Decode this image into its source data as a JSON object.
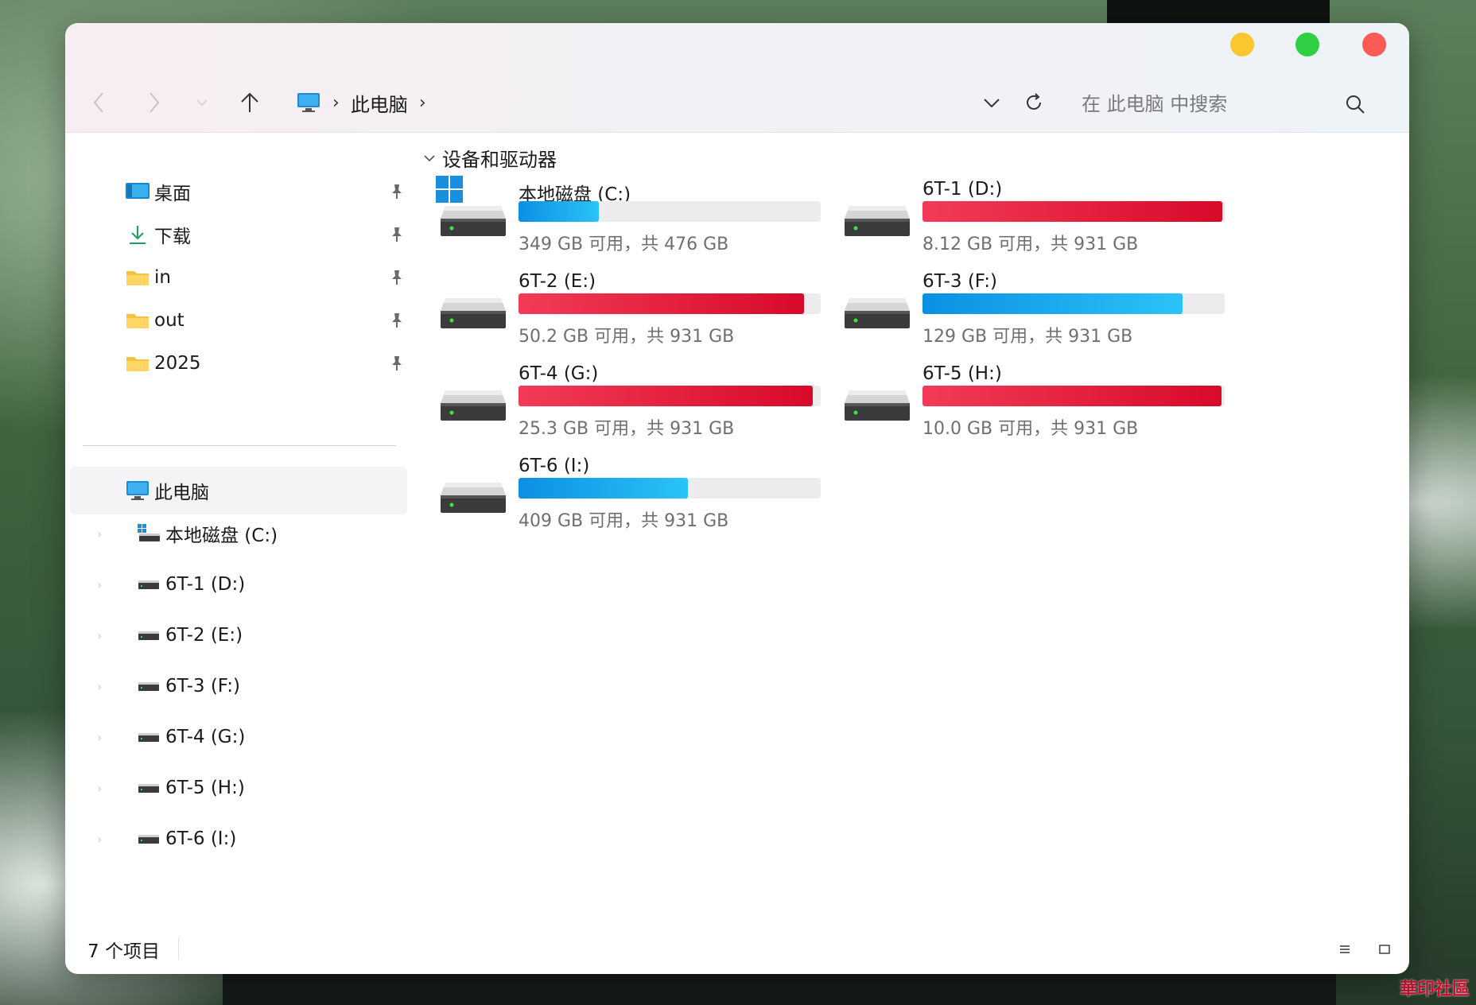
{
  "window": {
    "address": {
      "root_label": "此电脑",
      "search_placeholder": "在 此电脑 中搜索"
    }
  },
  "sidebar": {
    "quick_access": [
      {
        "label": "桌面",
        "icon": "desktop-icon",
        "pinned": true
      },
      {
        "label": "下载",
        "icon": "download-icon",
        "pinned": true
      },
      {
        "label": "in",
        "icon": "folder-icon",
        "pinned": true
      },
      {
        "label": "out",
        "icon": "folder-icon",
        "pinned": true
      },
      {
        "label": "2025",
        "icon": "folder-icon",
        "pinned": true
      }
    ],
    "this_pc_label": "此电脑",
    "drives": [
      {
        "label": "本地磁盘 (C:)",
        "icon": "system-drive-icon"
      },
      {
        "label": "6T-1 (D:)",
        "icon": "drive-icon"
      },
      {
        "label": "6T-2 (E:)",
        "icon": "drive-icon"
      },
      {
        "label": "6T-3 (F:)",
        "icon": "drive-icon"
      },
      {
        "label": "6T-4 (G:)",
        "icon": "drive-icon"
      },
      {
        "label": "6T-5 (H:)",
        "icon": "drive-icon"
      },
      {
        "label": "6T-6 (I:)",
        "icon": "drive-icon"
      }
    ]
  },
  "main": {
    "group_label": "设备和驱动器",
    "drives": [
      {
        "name": "本地磁盘 (C:)",
        "capacity": "349 GB 可用，共 476 GB",
        "used_fraction": 0.267,
        "status": "normal",
        "system": true
      },
      {
        "name": "6T-1 (D:)",
        "capacity": "8.12 GB 可用，共 931 GB",
        "used_fraction": 0.991,
        "status": "critical",
        "system": false
      },
      {
        "name": "6T-2 (E:)",
        "capacity": "50.2 GB 可用，共 931 GB",
        "used_fraction": 0.946,
        "status": "critical",
        "system": false
      },
      {
        "name": "6T-3 (F:)",
        "capacity": "129 GB 可用，共 931 GB",
        "used_fraction": 0.861,
        "status": "normal",
        "system": false
      },
      {
        "name": "6T-4 (G:)",
        "capacity": "25.3 GB 可用，共 931 GB",
        "used_fraction": 0.973,
        "status": "critical",
        "system": false
      },
      {
        "name": "6T-5 (H:)",
        "capacity": "10.0 GB 可用，共 931 GB",
        "used_fraction": 0.989,
        "status": "critical",
        "system": false
      },
      {
        "name": "6T-6 (I:)",
        "capacity": "409 GB 可用，共 931 GB",
        "used_fraction": 0.561,
        "status": "normal",
        "system": false
      }
    ]
  },
  "statusbar": {
    "item_count": "7 个项目"
  },
  "colors": {
    "bar_normal": "#0b90e3",
    "bar_critical": "#e0102f",
    "minimize": "#fbc62f",
    "maximize": "#2ecf43",
    "close": "#fc5a55"
  }
}
